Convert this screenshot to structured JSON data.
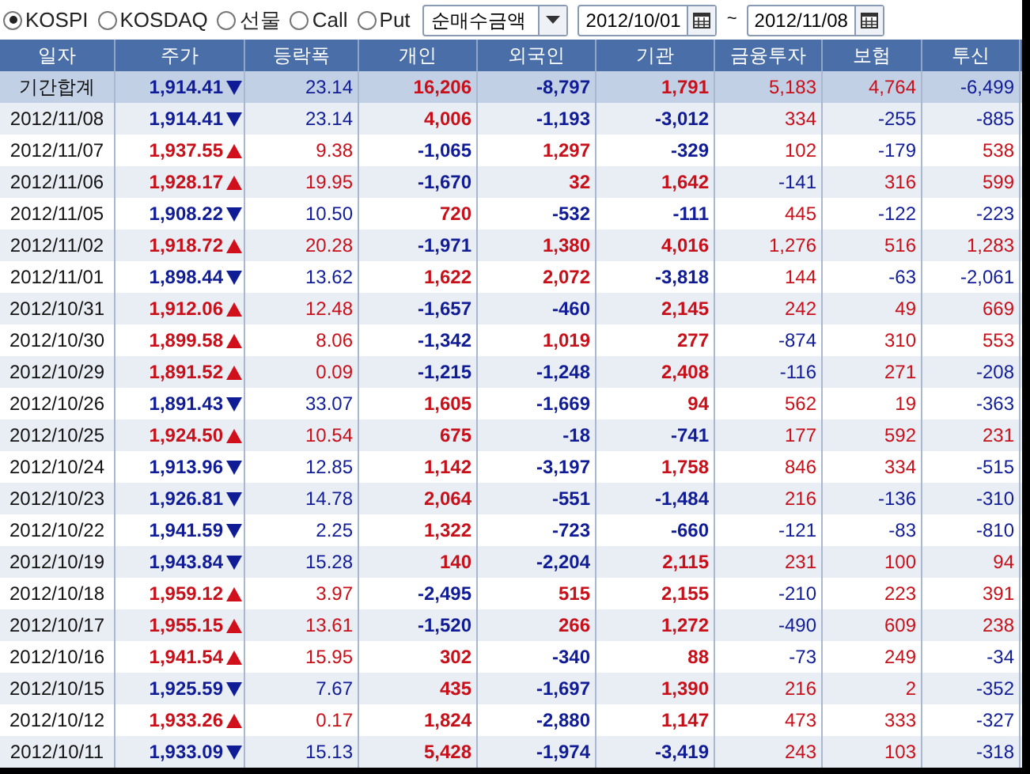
{
  "toolbar": {
    "markets": [
      {
        "label": "KOSPI",
        "selected": true
      },
      {
        "label": "KOSDAQ",
        "selected": false
      },
      {
        "label": "선물",
        "selected": false
      },
      {
        "label": "Call",
        "selected": false
      },
      {
        "label": "Put",
        "selected": false
      }
    ],
    "measure": "순매수금액",
    "date_from": "2012/10/01",
    "separator": "~",
    "date_to": "2012/11/08"
  },
  "table": {
    "columns": [
      "일자",
      "주가",
      "등락폭",
      "개인",
      "외국인",
      "기관",
      "금융투자",
      "보험",
      "투신"
    ],
    "rows": [
      {
        "kind": "total",
        "date": "기간합계",
        "price": "1,914.41",
        "rising": false,
        "change": "23.14",
        "individual": "16,206",
        "foreign": "-8,797",
        "institution": "1,791",
        "financial_investment": "5,183",
        "insurance": "4,764",
        "investment_trust": "-6,499"
      },
      {
        "kind": "day",
        "date": "2012/11/08",
        "price": "1,914.41",
        "rising": false,
        "change": "23.14",
        "individual": "4,006",
        "foreign": "-1,193",
        "institution": "-3,012",
        "financial_investment": "334",
        "insurance": "-255",
        "investment_trust": "-885"
      },
      {
        "kind": "day",
        "date": "2012/11/07",
        "price": "1,937.55",
        "rising": true,
        "change": "9.38",
        "individual": "-1,065",
        "foreign": "1,297",
        "institution": "-329",
        "financial_investment": "102",
        "insurance": "-179",
        "investment_trust": "538"
      },
      {
        "kind": "day",
        "date": "2012/11/06",
        "price": "1,928.17",
        "rising": true,
        "change": "19.95",
        "individual": "-1,670",
        "foreign": "32",
        "institution": "1,642",
        "financial_investment": "-141",
        "insurance": "316",
        "investment_trust": "599"
      },
      {
        "kind": "day",
        "date": "2012/11/05",
        "price": "1,908.22",
        "rising": false,
        "change": "10.50",
        "individual": "720",
        "foreign": "-532",
        "institution": "-111",
        "financial_investment": "445",
        "insurance": "-122",
        "investment_trust": "-223"
      },
      {
        "kind": "day",
        "date": "2012/11/02",
        "price": "1,918.72",
        "rising": true,
        "change": "20.28",
        "individual": "-1,971",
        "foreign": "1,380",
        "institution": "4,016",
        "financial_investment": "1,276",
        "insurance": "516",
        "investment_trust": "1,283"
      },
      {
        "kind": "day",
        "date": "2012/11/01",
        "price": "1,898.44",
        "rising": false,
        "change": "13.62",
        "individual": "1,622",
        "foreign": "2,072",
        "institution": "-3,818",
        "financial_investment": "144",
        "insurance": "-63",
        "investment_trust": "-2,061"
      },
      {
        "kind": "day",
        "date": "2012/10/31",
        "price": "1,912.06",
        "rising": true,
        "change": "12.48",
        "individual": "-1,657",
        "foreign": "-460",
        "institution": "2,145",
        "financial_investment": "242",
        "insurance": "49",
        "investment_trust": "669"
      },
      {
        "kind": "day",
        "date": "2012/10/30",
        "price": "1,899.58",
        "rising": true,
        "change": "8.06",
        "individual": "-1,342",
        "foreign": "1,019",
        "institution": "277",
        "financial_investment": "-874",
        "insurance": "310",
        "investment_trust": "553"
      },
      {
        "kind": "day",
        "date": "2012/10/29",
        "price": "1,891.52",
        "rising": true,
        "change": "0.09",
        "individual": "-1,215",
        "foreign": "-1,248",
        "institution": "2,408",
        "financial_investment": "-116",
        "insurance": "271",
        "investment_trust": "-208"
      },
      {
        "kind": "day",
        "date": "2012/10/26",
        "price": "1,891.43",
        "rising": false,
        "change": "33.07",
        "individual": "1,605",
        "foreign": "-1,669",
        "institution": "94",
        "financial_investment": "562",
        "insurance": "19",
        "investment_trust": "-363"
      },
      {
        "kind": "day",
        "date": "2012/10/25",
        "price": "1,924.50",
        "rising": true,
        "change": "10.54",
        "individual": "675",
        "foreign": "-18",
        "institution": "-741",
        "financial_investment": "177",
        "insurance": "592",
        "investment_trust": "231"
      },
      {
        "kind": "day",
        "date": "2012/10/24",
        "price": "1,913.96",
        "rising": false,
        "change": "12.85",
        "individual": "1,142",
        "foreign": "-3,197",
        "institution": "1,758",
        "financial_investment": "846",
        "insurance": "334",
        "investment_trust": "-515"
      },
      {
        "kind": "day",
        "date": "2012/10/23",
        "price": "1,926.81",
        "rising": false,
        "change": "14.78",
        "individual": "2,064",
        "foreign": "-551",
        "institution": "-1,484",
        "financial_investment": "216",
        "insurance": "-136",
        "investment_trust": "-310"
      },
      {
        "kind": "day",
        "date": "2012/10/22",
        "price": "1,941.59",
        "rising": false,
        "change": "2.25",
        "individual": "1,322",
        "foreign": "-723",
        "institution": "-660",
        "financial_investment": "-121",
        "insurance": "-83",
        "investment_trust": "-810"
      },
      {
        "kind": "day",
        "date": "2012/10/19",
        "price": "1,943.84",
        "rising": false,
        "change": "15.28",
        "individual": "140",
        "foreign": "-2,204",
        "institution": "2,115",
        "financial_investment": "231",
        "insurance": "100",
        "investment_trust": "94"
      },
      {
        "kind": "day",
        "date": "2012/10/18",
        "price": "1,959.12",
        "rising": true,
        "change": "3.97",
        "individual": "-2,495",
        "foreign": "515",
        "institution": "2,155",
        "financial_investment": "-210",
        "insurance": "223",
        "investment_trust": "391"
      },
      {
        "kind": "day",
        "date": "2012/10/17",
        "price": "1,955.15",
        "rising": true,
        "change": "13.61",
        "individual": "-1,520",
        "foreign": "266",
        "institution": "1,272",
        "financial_investment": "-490",
        "insurance": "609",
        "investment_trust": "238"
      },
      {
        "kind": "day",
        "date": "2012/10/16",
        "price": "1,941.54",
        "rising": true,
        "change": "15.95",
        "individual": "302",
        "foreign": "-340",
        "institution": "88",
        "financial_investment": "-73",
        "insurance": "249",
        "investment_trust": "-34"
      },
      {
        "kind": "day",
        "date": "2012/10/15",
        "price": "1,925.59",
        "rising": false,
        "change": "7.67",
        "individual": "435",
        "foreign": "-1,697",
        "institution": "1,390",
        "financial_investment": "216",
        "insurance": "2",
        "investment_trust": "-352"
      },
      {
        "kind": "day",
        "date": "2012/10/12",
        "price": "1,933.26",
        "rising": true,
        "change": "0.17",
        "individual": "1,824",
        "foreign": "-2,880",
        "institution": "1,147",
        "financial_investment": "473",
        "insurance": "333",
        "investment_trust": "-327"
      },
      {
        "kind": "day",
        "date": "2012/10/11",
        "price": "1,933.09",
        "rising": false,
        "change": "15.13",
        "individual": "5,428",
        "foreign": "-1,974",
        "institution": "-3,419",
        "financial_investment": "243",
        "insurance": "103",
        "investment_trust": "-318"
      }
    ]
  }
}
